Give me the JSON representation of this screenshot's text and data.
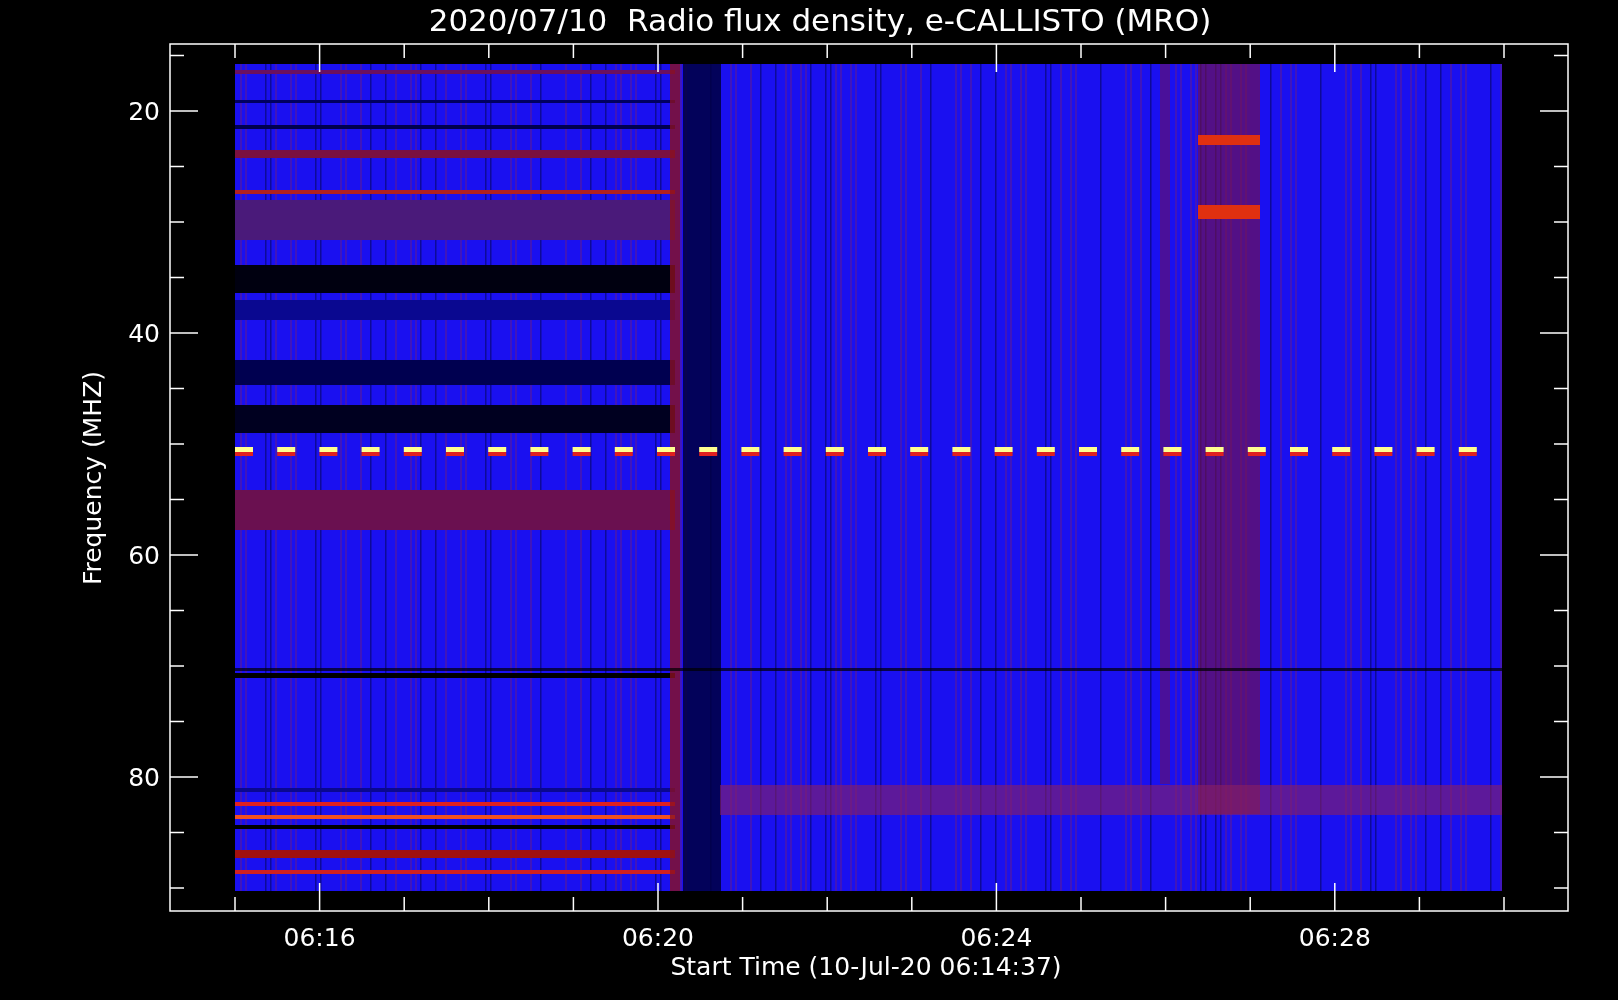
{
  "title": "2020/07/10  Radio flux density, e-CALLISTO (MRO)",
  "y_axis": {
    "label": "Frequency (MHZ)",
    "ticks": [
      "20",
      "40",
      "60",
      "80"
    ]
  },
  "x_axis": {
    "label": "Start Time (10-Jul-20 06:14:37)",
    "ticks": [
      "06:16",
      "06:20",
      "06:24",
      "06:28"
    ]
  }
}
